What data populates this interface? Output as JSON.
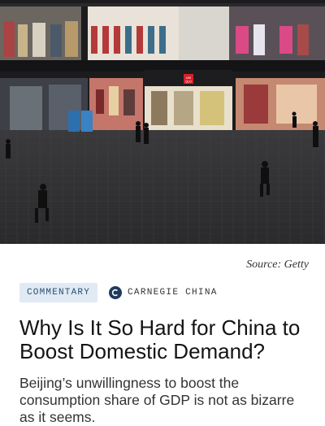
{
  "hero_image": {
    "store_sign": "UNI\nQLO"
  },
  "caption": {
    "text": "Source: Getty"
  },
  "meta": {
    "tag_label": "COMMENTARY",
    "org_name": "CARNEGIE CHINA",
    "org_logo_icon": "carnegie-c-logo-icon"
  },
  "article": {
    "title": "Why Is It So Hard for China to Boost Domestic Demand?",
    "dek": "Beijing’s unwillingness to boost the consumption share of GDP is not as bizarre as it seems."
  },
  "colors": {
    "tag_bg": "#dfeaf5",
    "tag_text": "#2d4d6d",
    "logo_bg": "#1f3a5f"
  }
}
